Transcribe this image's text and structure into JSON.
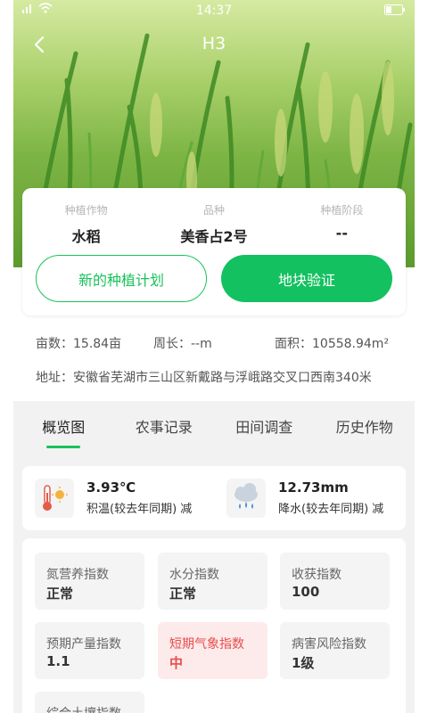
{
  "status_bar": {
    "time": "14:37"
  },
  "nav": {
    "title": "H3"
  },
  "info": {
    "columns": [
      {
        "label": "种植作物",
        "value": "水稻"
      },
      {
        "label": "品种",
        "value": "美香占2号"
      },
      {
        "label": "种植阶段",
        "value": "--"
      }
    ],
    "plan_button": "新的种植计划",
    "verify_button": "地块验证"
  },
  "meta": {
    "area_mu": "亩数：15.84亩",
    "perimeter": "周长：--m",
    "area_m2": "面积：10558.94m²",
    "address": "地址：安徽省芜湖市三山区新戴路与浮峨路交叉口西南340米"
  },
  "tabs": [
    "概览图",
    "农事记录",
    "田间调查",
    "历史作物"
  ],
  "weather": {
    "temp_value": "3.93℃",
    "temp_label": "积温(较去年同期) 减",
    "rain_value": "12.73mm",
    "rain_label": "降水(较去年同期) 减"
  },
  "indices": [
    {
      "label": "氮营养指数",
      "value": "正常"
    },
    {
      "label": "水分指数",
      "value": "正常"
    },
    {
      "label": "收获指数",
      "value": "100"
    },
    {
      "label": "预期产量指数",
      "value": "1.1"
    },
    {
      "label": "短期气象指数",
      "value": "中"
    },
    {
      "label": "病害风险指数",
      "value": "1级"
    },
    {
      "label": "综合土壤指数",
      "value": ""
    }
  ],
  "colors": {
    "accent": "#19c25a",
    "alert": "#e84d4d"
  }
}
